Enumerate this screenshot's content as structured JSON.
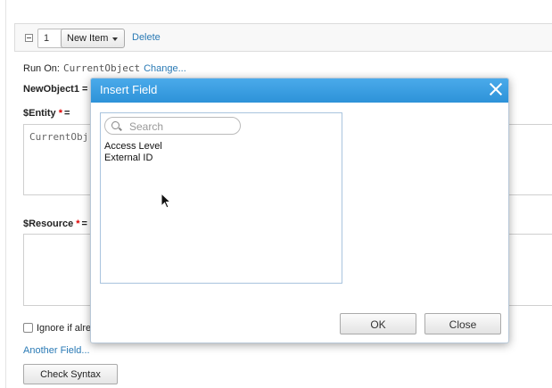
{
  "item_bar": {
    "number": "1",
    "item_select": "New Item",
    "delete_label": "Delete"
  },
  "run_on": {
    "label": "Run On:",
    "value": "CurrentObject",
    "change_label": "Change..."
  },
  "new_object_label": "NewObject1 =",
  "entity": {
    "label": "$Entity",
    "required": "*",
    "equals": "=",
    "value": "CurrentObj"
  },
  "resource": {
    "label": "$Resource",
    "required": "*",
    "equals": "="
  },
  "ignore_label": "Ignore if alre",
  "another_field_label": "Another Field...",
  "check_syntax_label": "Check Syntax",
  "modal": {
    "title": "Insert Field",
    "search_placeholder": "Search",
    "items": [
      "Access Level",
      "External ID"
    ],
    "ok_label": "OK",
    "close_label": "Close"
  },
  "colors": {
    "modal_header": "#3a9fe2",
    "link": "#2a7ab5",
    "required": "#dd0000"
  }
}
